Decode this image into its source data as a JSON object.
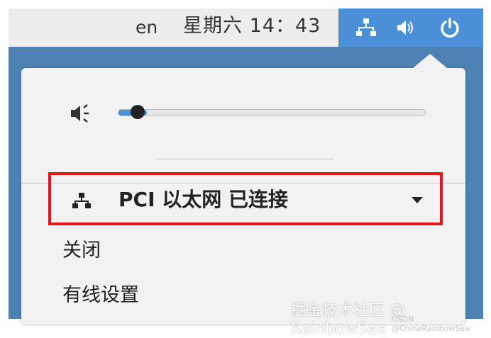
{
  "top_bar": {
    "input_language": "en",
    "clock": "星期六 14：43",
    "icons": [
      "network-wired-icon",
      "volume-icon",
      "power-icon"
    ]
  },
  "popup": {
    "volume": {
      "icon": "volume-icon",
      "level": 0.07
    },
    "network": {
      "icon": "network-wired-icon",
      "label": "PCI 以太网  已连接",
      "expanded": false
    },
    "submenu": {
      "items": [
        {
          "label": "关闭"
        },
        {
          "label": "有线设置"
        }
      ]
    }
  },
  "watermark": {
    "text": "掘金技术社区 @ RainbowSea",
    "small_text": "CSDN @ChinaRainbowSea"
  },
  "colors": {
    "panel_bg": "#ededed",
    "system_menu_bg": "#4a90d9",
    "popup_bg": "#f2f2f2",
    "highlight_border": "#e8141a",
    "slider_fill": "#4a90d9"
  }
}
